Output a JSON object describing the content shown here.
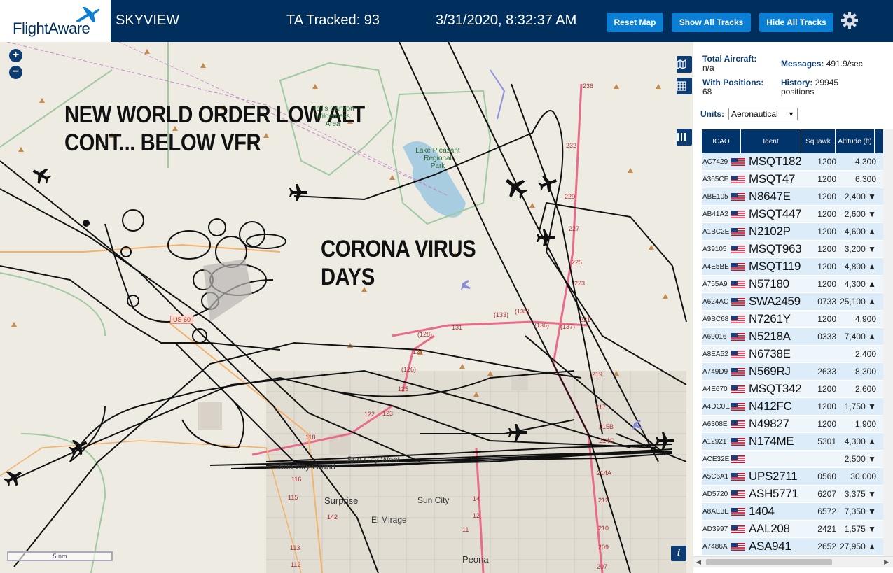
{
  "header": {
    "logo_text": "FlightAware",
    "title": "SKYVIEW",
    "tracked": "TA Tracked: 93",
    "datetime": "3/31/2020, 8:32:37 AM",
    "buttons": {
      "reset": "Reset Map",
      "show": "Show All Tracks",
      "hide": "Hide All Tracks"
    },
    "accent_color": "#002f5d",
    "button_color": "#0a7fd4"
  },
  "map": {
    "overlay_text_1": [
      "NEW WORLD ORDER LOW ALT",
      "CONT... BELOW VFR"
    ],
    "overlay_text_2": [
      "CORONA VIRUS",
      "DAYS"
    ],
    "places": [
      "Surprise",
      "Sun City",
      "El Mirage",
      "Peoria",
      "Sun City Grand",
      "Sun City West"
    ],
    "park_labels": [
      "Lake Pleasant\nRegional\nPark",
      "Hell's Canyon\nWilderness\nArea"
    ],
    "road_label": "US 60",
    "route_numbers": [
      "236",
      "232",
      "229",
      "227",
      "225",
      "223",
      "221",
      "219",
      "217",
      "215B",
      "214C",
      "214A",
      "212",
      "210",
      "209",
      "207",
      "131",
      "(133)",
      "(135)",
      "(136)",
      "(137)",
      "(128)",
      "127",
      "(126)",
      "125",
      "123",
      "122",
      "118",
      "116",
      "115",
      "113",
      "112",
      "142",
      "14",
      "12",
      "11"
    ],
    "scale": "5 nm",
    "zoom_in": "+",
    "zoom_out": "−",
    "info": "i"
  },
  "sidebar": {
    "total_aircraft_label": "Total Aircraft:",
    "total_aircraft_value": "n/a",
    "with_positions_label": "With Positions:",
    "with_positions_value": "68",
    "messages_label": "Messages:",
    "messages_value": "491.9/sec",
    "history_label": "History:",
    "history_value": "29945",
    "history_unit": "positions",
    "units_label": "Units:",
    "units_value": "Aeronautical",
    "columns": {
      "icao": "ICAO",
      "ident": "Ident",
      "squawk": "Squawk",
      "altitude": "Altitude (ft)"
    },
    "rows": [
      {
        "icao": "AC7429",
        "ident": "MSQT182",
        "squawk": "1200",
        "alt": "4,300"
      },
      {
        "icao": "A365CF",
        "ident": "MSQT47",
        "squawk": "1200",
        "alt": "6,300"
      },
      {
        "icao": "ABE105",
        "ident": "N8647E",
        "squawk": "1200",
        "alt": "2,400 ▼"
      },
      {
        "icao": "AB41A2",
        "ident": "MSQT447",
        "squawk": "1200",
        "alt": "2,600 ▼"
      },
      {
        "icao": "A1BC2E",
        "ident": "N2102P",
        "squawk": "1200",
        "alt": "4,600 ▲"
      },
      {
        "icao": "A39105",
        "ident": "MSQT963",
        "squawk": "1200",
        "alt": "3,200 ▼"
      },
      {
        "icao": "A4E5BE",
        "ident": "MSQT119",
        "squawk": "1200",
        "alt": "4,800 ▲"
      },
      {
        "icao": "A755A9",
        "ident": "N57180",
        "squawk": "1200",
        "alt": "4,300 ▲"
      },
      {
        "icao": "A624AC",
        "ident": "SWA2459",
        "squawk": "0733",
        "alt": "25,100 ▲"
      },
      {
        "icao": "A9BC68",
        "ident": "N7261Y",
        "squawk": "1200",
        "alt": "4,900"
      },
      {
        "icao": "A69016",
        "ident": "N5218A",
        "squawk": "0333",
        "alt": "7,400 ▲"
      },
      {
        "icao": "A8EA52",
        "ident": "N6738E",
        "squawk": "",
        "alt": "2,400"
      },
      {
        "icao": "A749D9",
        "ident": "N569RJ",
        "squawk": "2633",
        "alt": "8,300"
      },
      {
        "icao": "A4E670",
        "ident": "MSQT342",
        "squawk": "1200",
        "alt": "2,600"
      },
      {
        "icao": "A4DC0E",
        "ident": "N412FC",
        "squawk": "1200",
        "alt": "1,750 ▼"
      },
      {
        "icao": "A6308E",
        "ident": "N49827",
        "squawk": "1200",
        "alt": "1,900"
      },
      {
        "icao": "A12921",
        "ident": "N174ME",
        "squawk": "5301",
        "alt": "4,300 ▲"
      },
      {
        "icao": "ACE32E",
        "ident": "",
        "squawk": "",
        "alt": "2,500 ▼"
      },
      {
        "icao": "A5C6A1",
        "ident": "UPS2711",
        "squawk": "0560",
        "alt": "30,000"
      },
      {
        "icao": "AD5720",
        "ident": "ASH5771",
        "squawk": "6207",
        "alt": "3,375 ▼"
      },
      {
        "icao": "A8AE3E",
        "ident": "1404",
        "squawk": "6572",
        "alt": "7,350 ▼"
      },
      {
        "icao": "AD3997",
        "ident": "AAL208",
        "squawk": "2421",
        "alt": "1,575 ▼"
      },
      {
        "icao": "A7486A",
        "ident": "ASA941",
        "squawk": "2652",
        "alt": "27,950 ▲"
      }
    ]
  }
}
